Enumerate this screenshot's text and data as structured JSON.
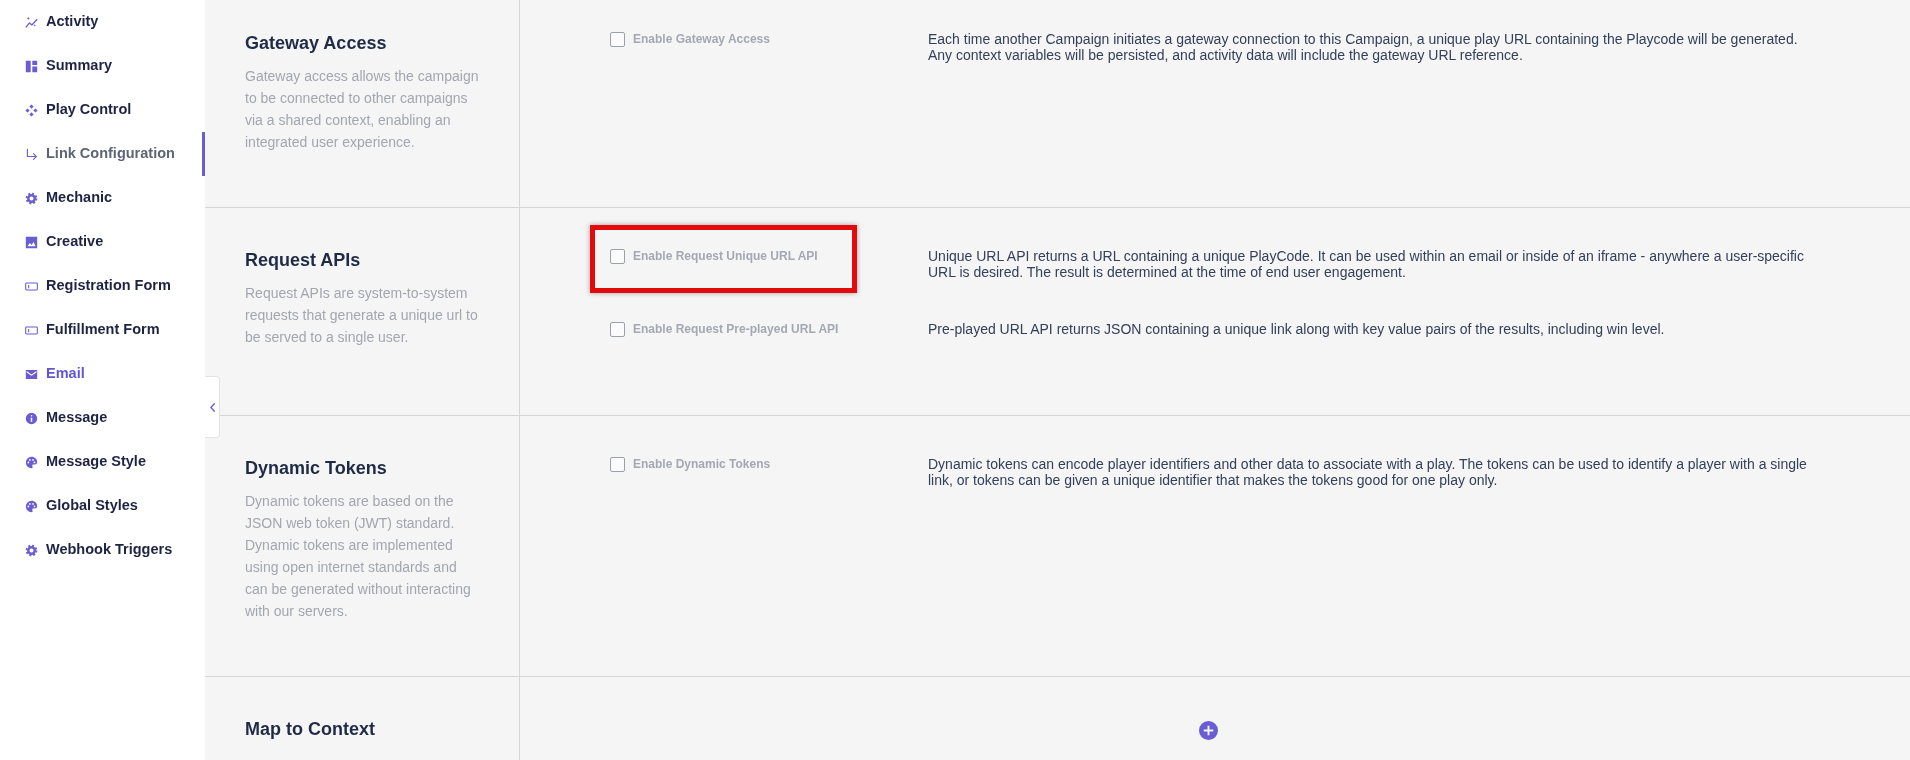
{
  "sidebar": {
    "items": [
      {
        "label": "Activity",
        "selected": false,
        "hovered": false
      },
      {
        "label": "Summary",
        "selected": false,
        "hovered": false
      },
      {
        "label": "Play Control",
        "selected": false,
        "hovered": false
      },
      {
        "label": "Link Configuration",
        "selected": true,
        "hovered": false
      },
      {
        "label": "Mechanic",
        "selected": false,
        "hovered": false
      },
      {
        "label": "Creative",
        "selected": false,
        "hovered": false
      },
      {
        "label": "Registration Form",
        "selected": false,
        "hovered": false
      },
      {
        "label": "Fulfillment Form",
        "selected": false,
        "hovered": false
      },
      {
        "label": "Email",
        "selected": false,
        "hovered": true
      },
      {
        "label": "Message",
        "selected": false,
        "hovered": false
      },
      {
        "label": "Message Style",
        "selected": false,
        "hovered": false
      },
      {
        "label": "Global Styles",
        "selected": false,
        "hovered": false
      },
      {
        "label": "Webhook Triggers",
        "selected": false,
        "hovered": false
      }
    ]
  },
  "sections": [
    {
      "title": "Gateway Access",
      "description": "Gateway access allows the campaign to be connected to other campaigns via a shared context, enabling an integrated user experience.",
      "options": [
        {
          "kind": "checkbox",
          "label": "Enable Gateway Access",
          "checked": false,
          "highlighted": false,
          "description": "Each time another Campaign initiates a gateway connection to this Campaign, a unique play URL containing the Playcode will be generated.\nAny context variables will be persisted, and activity data will include the gateway URL reference."
        }
      ]
    },
    {
      "title": "Request APIs",
      "description": "Request APIs are system-to-system requests that generate a unique url to be served to a single user.",
      "options": [
        {
          "kind": "checkbox",
          "label": "Enable Request Unique URL API",
          "checked": false,
          "highlighted": true,
          "description": "Unique URL API returns a URL containing a unique PlayCode. It can be used within an email or inside of an iframe - anywhere a user-specific URL is desired. The result is determined at the time of end user engagement."
        },
        {
          "kind": "checkbox",
          "label": "Enable Request Pre-played URL API",
          "checked": false,
          "highlighted": false,
          "description": "Pre-played URL API returns JSON containing a unique link along with key value pairs of the results, including win level."
        }
      ]
    },
    {
      "title": "Dynamic Tokens",
      "description": "Dynamic tokens are based on the JSON web token (JWT) standard. Dynamic tokens are implemented using open internet standards and can be generated without interacting with our servers.",
      "options": [
        {
          "kind": "checkbox",
          "label": "Enable Dynamic Tokens",
          "checked": false,
          "highlighted": false,
          "description": "Dynamic tokens can encode player identifiers and other data to associate with a play. The tokens can be used to identify a player with a single link, or tokens can be given a unique identifier that makes the tokens good for one play only."
        }
      ]
    },
    {
      "title": "Map to Context",
      "options": [
        {
          "kind": "add"
        }
      ]
    }
  ]
}
